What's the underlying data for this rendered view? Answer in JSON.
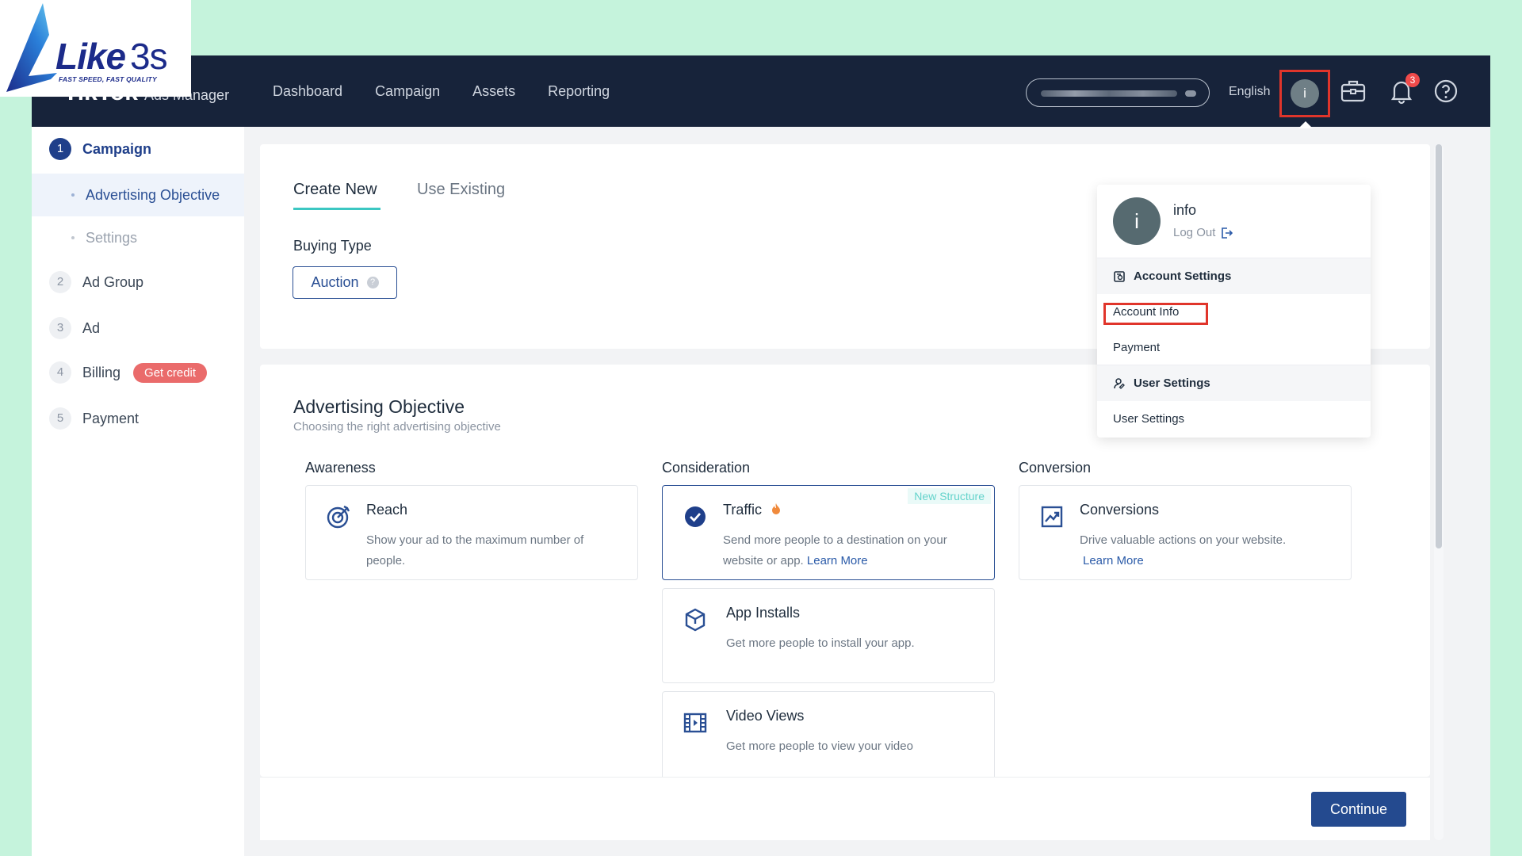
{
  "watermark": {
    "brand": "Like",
    "brand_num": "3s",
    "tagline": "FAST SPEED, FAST QUALITY"
  },
  "topbar": {
    "brand": "TikTok",
    "brand_sub": "Ads Manager",
    "nav": [
      "Dashboard",
      "Campaign",
      "Assets",
      "Reporting"
    ],
    "language": "English",
    "avatar_letter": "i",
    "notification_count": "3",
    "icons": [
      "briefcase-icon",
      "bell-icon",
      "help-icon"
    ]
  },
  "sidebar": {
    "steps": [
      {
        "num": "1",
        "label": "Campaign"
      },
      {
        "num": "2",
        "label": "Ad Group"
      },
      {
        "num": "3",
        "label": "Ad"
      },
      {
        "num": "4",
        "label": "Billing"
      },
      {
        "num": "5",
        "label": "Payment"
      }
    ],
    "substeps": [
      "Advertising Objective",
      "Settings"
    ],
    "get_credit": "Get credit"
  },
  "main": {
    "tabs": [
      "Create New",
      "Use Existing"
    ],
    "buying_type_label": "Buying Type",
    "buying_type_value": "Auction",
    "objective_title": "Advertising Objective",
    "objective_subtitle": "Choosing the right advertising objective",
    "columns": [
      "Awareness",
      "Consideration",
      "Conversion"
    ],
    "objectives": {
      "reach": {
        "title": "Reach",
        "desc": "Show your ad to the maximum number of people."
      },
      "traffic": {
        "title": "Traffic",
        "desc": "Send more people to a destination on your website or app.",
        "link": "Learn More",
        "tag": "New Structure"
      },
      "app_installs": {
        "title": "App Installs",
        "desc": "Get more people to install your app."
      },
      "video_views": {
        "title": "Video Views",
        "desc": "Get more people to view your video"
      },
      "conversions": {
        "title": "Conversions",
        "desc": "Drive valuable actions on your website.",
        "link": "Learn More"
      }
    },
    "continue_label": "Continue"
  },
  "dropdown": {
    "name": "info",
    "logout": "Log Out",
    "account_settings_header": "Account Settings",
    "account_items": [
      "Account Info",
      "Payment"
    ],
    "user_settings_header": "User Settings",
    "user_items": [
      "User Settings"
    ]
  },
  "colors": {
    "topbar": "#17233a",
    "primary": "#244a8f",
    "accent_teal": "#3cc7c2",
    "highlight": "#e0352b",
    "badge": "#f04a4a"
  }
}
